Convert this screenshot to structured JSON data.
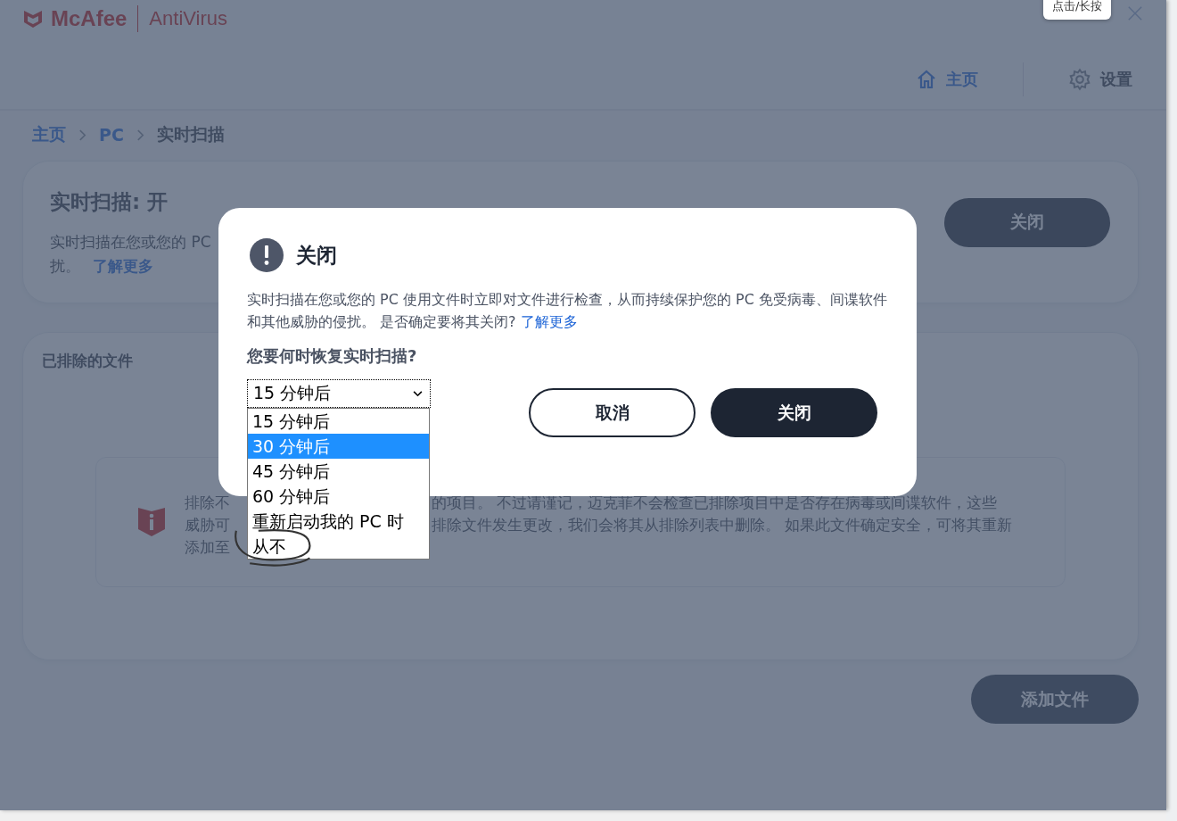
{
  "header": {
    "brand": "McAfee",
    "product": "AntiVirus",
    "tooltip": "点击/长按"
  },
  "nav": [
    {
      "kind": "home",
      "label": "主页"
    },
    {
      "kind": "settings",
      "label": "设置"
    }
  ],
  "breadcrumb": [
    "主页",
    "PC",
    "实时扫描"
  ],
  "scan_card": {
    "title": "实时扫描: 开",
    "description_line_1": "实时扫描在您或您的 PC",
    "description_line_2": "扰。",
    "link": "了解更多",
    "button": "关闭"
  },
  "excluded_card": {
    "title": "已排除的文件",
    "notice_left": [
      "排除不",
      "威胁可",
      "添加至"
    ],
    "notice_right": [
      "的项目。 不过请谨记，迈克菲不会检查已排除项目中是否存在病毒或间谍软件，这些",
      "排除文件发生更改，我们会将其从排除列表中删除。 如果此文件确定安全，可将其重新"
    ]
  },
  "add_button": "添加文件",
  "dialog": {
    "title": "关闭",
    "message": "实时扫描在您或您的 PC 使用文件时立即对文件进行检查，从而持续保护您的 PC 免受病毒、间谍软件和其他威胁的侵扰。 是否确定要将其关闭?",
    "link": "了解更多",
    "question": "您要何时恢复实时扫描?",
    "select": {
      "value": "15 分钟后"
    },
    "options": [
      {
        "label": "15 分钟后",
        "selected": false
      },
      {
        "label": "30 分钟后",
        "selected": true
      },
      {
        "label": "45 分钟后",
        "selected": false
      },
      {
        "label": "60 分钟后",
        "selected": false
      },
      {
        "label": "重新启动我的 PC 时",
        "selected": false
      },
      {
        "label": "从不",
        "selected": false
      }
    ],
    "buttons": [
      {
        "kind": "secondary",
        "label": "取消"
      },
      {
        "kind": "primary",
        "label": "关闭"
      }
    ]
  }
}
